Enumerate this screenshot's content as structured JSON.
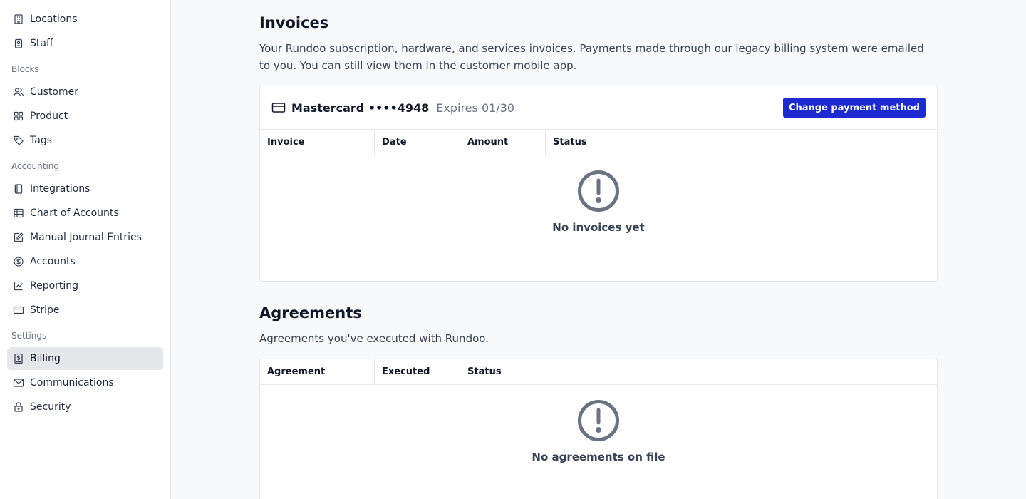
{
  "sidebar": {
    "items_top": [
      {
        "label": "Locations",
        "icon": "building-icon"
      },
      {
        "label": "Staff",
        "icon": "badge-icon"
      }
    ],
    "sections": [
      {
        "title": "Blocks",
        "items": [
          {
            "label": "Customer",
            "icon": "users-icon"
          },
          {
            "label": "Product",
            "icon": "grid-icon"
          },
          {
            "label": "Tags",
            "icon": "tag-icon"
          }
        ]
      },
      {
        "title": "Accounting",
        "items": [
          {
            "label": "Integrations",
            "icon": "notebook-icon"
          },
          {
            "label": "Chart of Accounts",
            "icon": "table-icon"
          },
          {
            "label": "Manual Journal Entries",
            "icon": "edit-note-icon"
          },
          {
            "label": "Accounts",
            "icon": "dollar-circle-icon"
          },
          {
            "label": "Reporting",
            "icon": "line-chart-icon"
          },
          {
            "label": "Stripe",
            "icon": "credit-card-icon"
          }
        ]
      },
      {
        "title": "Settings",
        "items": [
          {
            "label": "Billing",
            "icon": "billing-icon",
            "active": true
          },
          {
            "label": "Communications",
            "icon": "mail-icon"
          },
          {
            "label": "Security",
            "icon": "lock-icon"
          }
        ]
      }
    ]
  },
  "invoices": {
    "title": "Invoices",
    "description": "Your Rundoo subscription, hardware, and services invoices. Payments made through our legacy billing system were emailed to you. You can still view them in the customer mobile app.",
    "card_name": "Mastercard ••••4948",
    "card_expiry": "Expires 01/30",
    "change_button": "Change payment method",
    "columns": [
      "Invoice",
      "Date",
      "Amount",
      "Status"
    ],
    "empty_text": "No invoices yet"
  },
  "agreements": {
    "title": "Agreements",
    "description": "Agreements you've executed with Rundoo.",
    "columns": [
      "Agreement",
      "Executed",
      "Status"
    ],
    "empty_text": "No agreements on file"
  },
  "colors": {
    "accent": "#1c2bd1",
    "active_nav_bg": "#e5e7eb"
  }
}
